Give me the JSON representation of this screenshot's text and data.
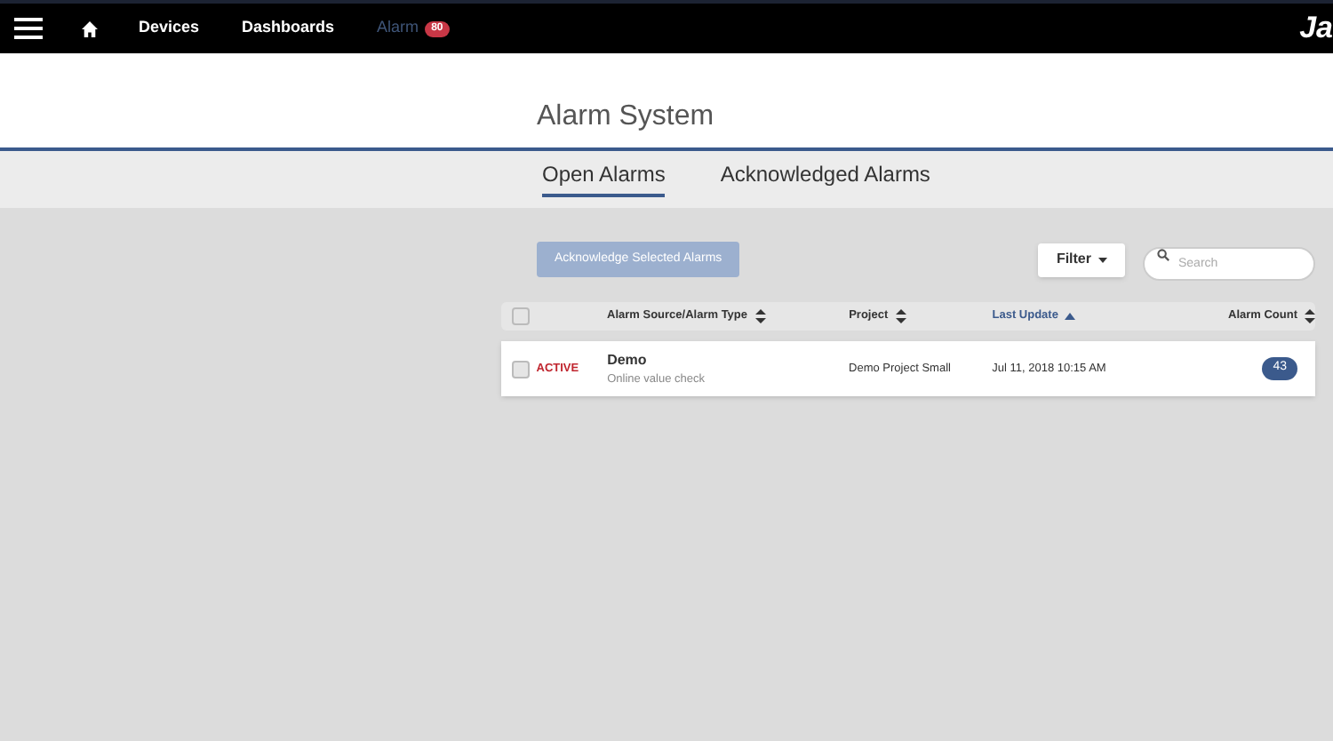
{
  "navbar": {
    "items": [
      {
        "kind": "menu"
      },
      {
        "kind": "home"
      },
      {
        "kind": "link",
        "label": "Devices",
        "selected": false
      },
      {
        "kind": "link",
        "label": "Dashboards",
        "selected": false
      },
      {
        "kind": "link",
        "label": "Alarm",
        "selected": true,
        "badge": "80"
      }
    ],
    "logo": "Ja"
  },
  "page_title": "Alarm System",
  "tabs": [
    {
      "label": "Open Alarms",
      "selected": true
    },
    {
      "label": "Acknowledged Alarms",
      "selected": false
    }
  ],
  "acknowledge_button": {
    "label": "Acknowledge Selected Alarms",
    "disabled": true
  },
  "filter_button": {
    "label": "Filter"
  },
  "search": {
    "placeholder": "Search"
  },
  "table": {
    "header_checked": false,
    "columns": [
      {
        "label": "Alarm Source/Alarm Type",
        "sorted": false
      },
      {
        "label": "Project",
        "sorted": false
      },
      {
        "label": "Last Update",
        "sorted": true
      },
      {
        "label": "Alarm Count",
        "sorted": false
      }
    ],
    "rows": [
      {
        "checked": false,
        "status": "ACTIVE",
        "source": "Demo",
        "type": "Online value check",
        "project": "Demo Project Small",
        "last_update": "Jul 11, 2018 10:15 AM",
        "count": "43"
      }
    ]
  }
}
